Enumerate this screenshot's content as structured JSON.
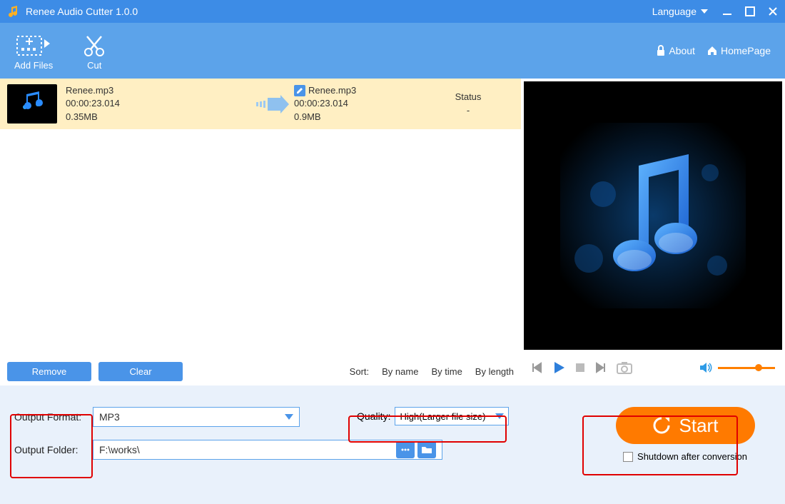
{
  "titlebar": {
    "title": "Renee Audio Cutter 1.0.0",
    "language": "Language"
  },
  "toolbar": {
    "add_files": "Add Files",
    "cut": "Cut",
    "about": "About",
    "homepage": "HomePage"
  },
  "file": {
    "src": {
      "name": "Renee.mp3",
      "duration": "00:00:23.014",
      "size": "0.35MB"
    },
    "dst": {
      "name": "Renee.mp3",
      "duration": "00:00:23.014",
      "size": "0.9MB"
    },
    "status_label": "Status",
    "status_value": "-"
  },
  "listfooter": {
    "remove": "Remove",
    "clear": "Clear",
    "sort_label": "Sort:",
    "by_name": "By name",
    "by_time": "By time",
    "by_length": "By length"
  },
  "output": {
    "format_label": "Output Format:",
    "format_value": "MP3",
    "folder_label": "Output Folder:",
    "folder_value": "F:\\works\\",
    "quality_label": "Quality:",
    "quality_value": "High(Larger file size)"
  },
  "actions": {
    "start": "Start",
    "shutdown": "Shutdown after conversion"
  }
}
